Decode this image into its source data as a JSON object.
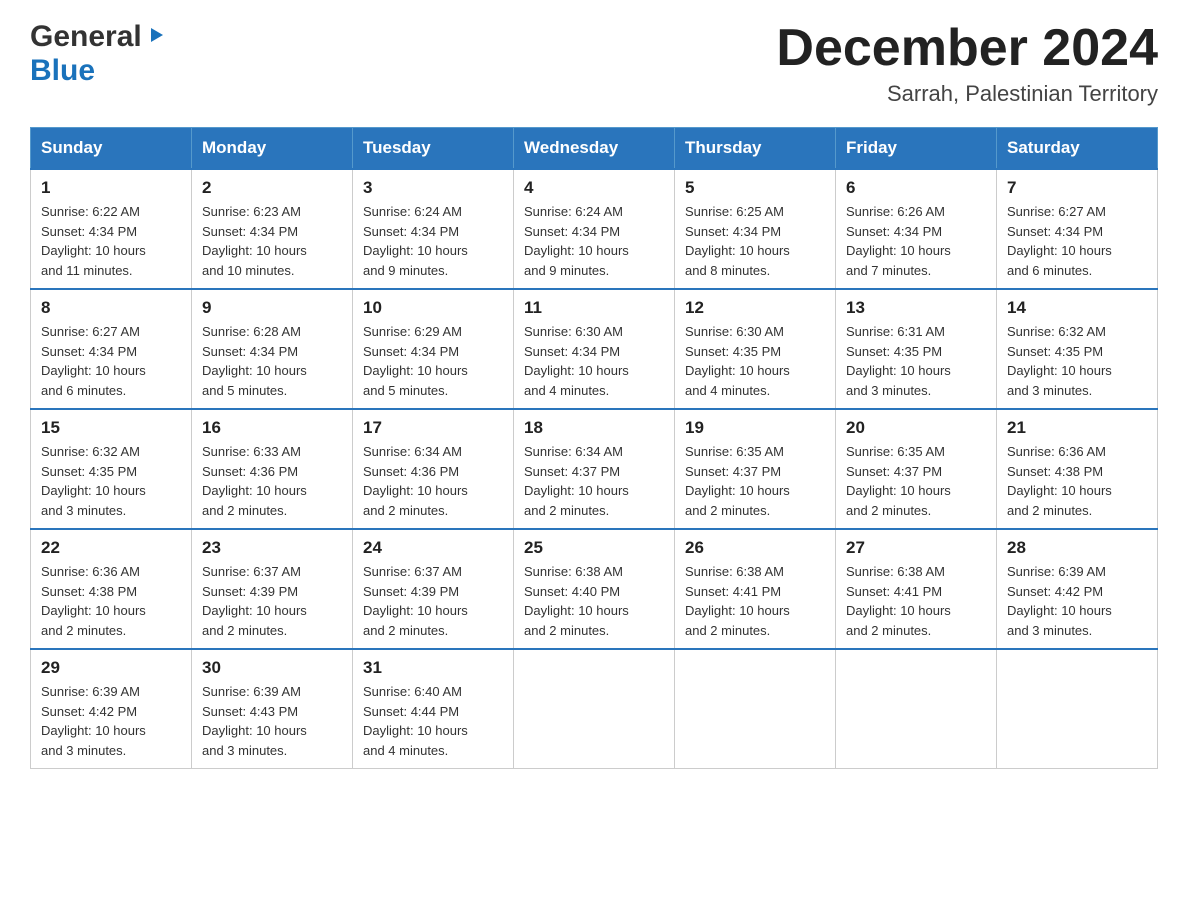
{
  "header": {
    "logo_general": "General",
    "logo_blue": "Blue",
    "title": "December 2024",
    "location": "Sarrah, Palestinian Territory"
  },
  "days_of_week": [
    "Sunday",
    "Monday",
    "Tuesday",
    "Wednesday",
    "Thursday",
    "Friday",
    "Saturday"
  ],
  "weeks": [
    [
      {
        "day": "1",
        "sunrise": "6:22 AM",
        "sunset": "4:34 PM",
        "daylight": "10 hours and 11 minutes."
      },
      {
        "day": "2",
        "sunrise": "6:23 AM",
        "sunset": "4:34 PM",
        "daylight": "10 hours and 10 minutes."
      },
      {
        "day": "3",
        "sunrise": "6:24 AM",
        "sunset": "4:34 PM",
        "daylight": "10 hours and 9 minutes."
      },
      {
        "day": "4",
        "sunrise": "6:24 AM",
        "sunset": "4:34 PM",
        "daylight": "10 hours and 9 minutes."
      },
      {
        "day": "5",
        "sunrise": "6:25 AM",
        "sunset": "4:34 PM",
        "daylight": "10 hours and 8 minutes."
      },
      {
        "day": "6",
        "sunrise": "6:26 AM",
        "sunset": "4:34 PM",
        "daylight": "10 hours and 7 minutes."
      },
      {
        "day": "7",
        "sunrise": "6:27 AM",
        "sunset": "4:34 PM",
        "daylight": "10 hours and 6 minutes."
      }
    ],
    [
      {
        "day": "8",
        "sunrise": "6:27 AM",
        "sunset": "4:34 PM",
        "daylight": "10 hours and 6 minutes."
      },
      {
        "day": "9",
        "sunrise": "6:28 AM",
        "sunset": "4:34 PM",
        "daylight": "10 hours and 5 minutes."
      },
      {
        "day": "10",
        "sunrise": "6:29 AM",
        "sunset": "4:34 PM",
        "daylight": "10 hours and 5 minutes."
      },
      {
        "day": "11",
        "sunrise": "6:30 AM",
        "sunset": "4:34 PM",
        "daylight": "10 hours and 4 minutes."
      },
      {
        "day": "12",
        "sunrise": "6:30 AM",
        "sunset": "4:35 PM",
        "daylight": "10 hours and 4 minutes."
      },
      {
        "day": "13",
        "sunrise": "6:31 AM",
        "sunset": "4:35 PM",
        "daylight": "10 hours and 3 minutes."
      },
      {
        "day": "14",
        "sunrise": "6:32 AM",
        "sunset": "4:35 PM",
        "daylight": "10 hours and 3 minutes."
      }
    ],
    [
      {
        "day": "15",
        "sunrise": "6:32 AM",
        "sunset": "4:35 PM",
        "daylight": "10 hours and 3 minutes."
      },
      {
        "day": "16",
        "sunrise": "6:33 AM",
        "sunset": "4:36 PM",
        "daylight": "10 hours and 2 minutes."
      },
      {
        "day": "17",
        "sunrise": "6:34 AM",
        "sunset": "4:36 PM",
        "daylight": "10 hours and 2 minutes."
      },
      {
        "day": "18",
        "sunrise": "6:34 AM",
        "sunset": "4:37 PM",
        "daylight": "10 hours and 2 minutes."
      },
      {
        "day": "19",
        "sunrise": "6:35 AM",
        "sunset": "4:37 PM",
        "daylight": "10 hours and 2 minutes."
      },
      {
        "day": "20",
        "sunrise": "6:35 AM",
        "sunset": "4:37 PM",
        "daylight": "10 hours and 2 minutes."
      },
      {
        "day": "21",
        "sunrise": "6:36 AM",
        "sunset": "4:38 PM",
        "daylight": "10 hours and 2 minutes."
      }
    ],
    [
      {
        "day": "22",
        "sunrise": "6:36 AM",
        "sunset": "4:38 PM",
        "daylight": "10 hours and 2 minutes."
      },
      {
        "day": "23",
        "sunrise": "6:37 AM",
        "sunset": "4:39 PM",
        "daylight": "10 hours and 2 minutes."
      },
      {
        "day": "24",
        "sunrise": "6:37 AM",
        "sunset": "4:39 PM",
        "daylight": "10 hours and 2 minutes."
      },
      {
        "day": "25",
        "sunrise": "6:38 AM",
        "sunset": "4:40 PM",
        "daylight": "10 hours and 2 minutes."
      },
      {
        "day": "26",
        "sunrise": "6:38 AM",
        "sunset": "4:41 PM",
        "daylight": "10 hours and 2 minutes."
      },
      {
        "day": "27",
        "sunrise": "6:38 AM",
        "sunset": "4:41 PM",
        "daylight": "10 hours and 2 minutes."
      },
      {
        "day": "28",
        "sunrise": "6:39 AM",
        "sunset": "4:42 PM",
        "daylight": "10 hours and 3 minutes."
      }
    ],
    [
      {
        "day": "29",
        "sunrise": "6:39 AM",
        "sunset": "4:42 PM",
        "daylight": "10 hours and 3 minutes."
      },
      {
        "day": "30",
        "sunrise": "6:39 AM",
        "sunset": "4:43 PM",
        "daylight": "10 hours and 3 minutes."
      },
      {
        "day": "31",
        "sunrise": "6:40 AM",
        "sunset": "4:44 PM",
        "daylight": "10 hours and 4 minutes."
      },
      null,
      null,
      null,
      null
    ]
  ],
  "labels": {
    "sunrise": "Sunrise:",
    "sunset": "Sunset:",
    "daylight": "Daylight:"
  }
}
